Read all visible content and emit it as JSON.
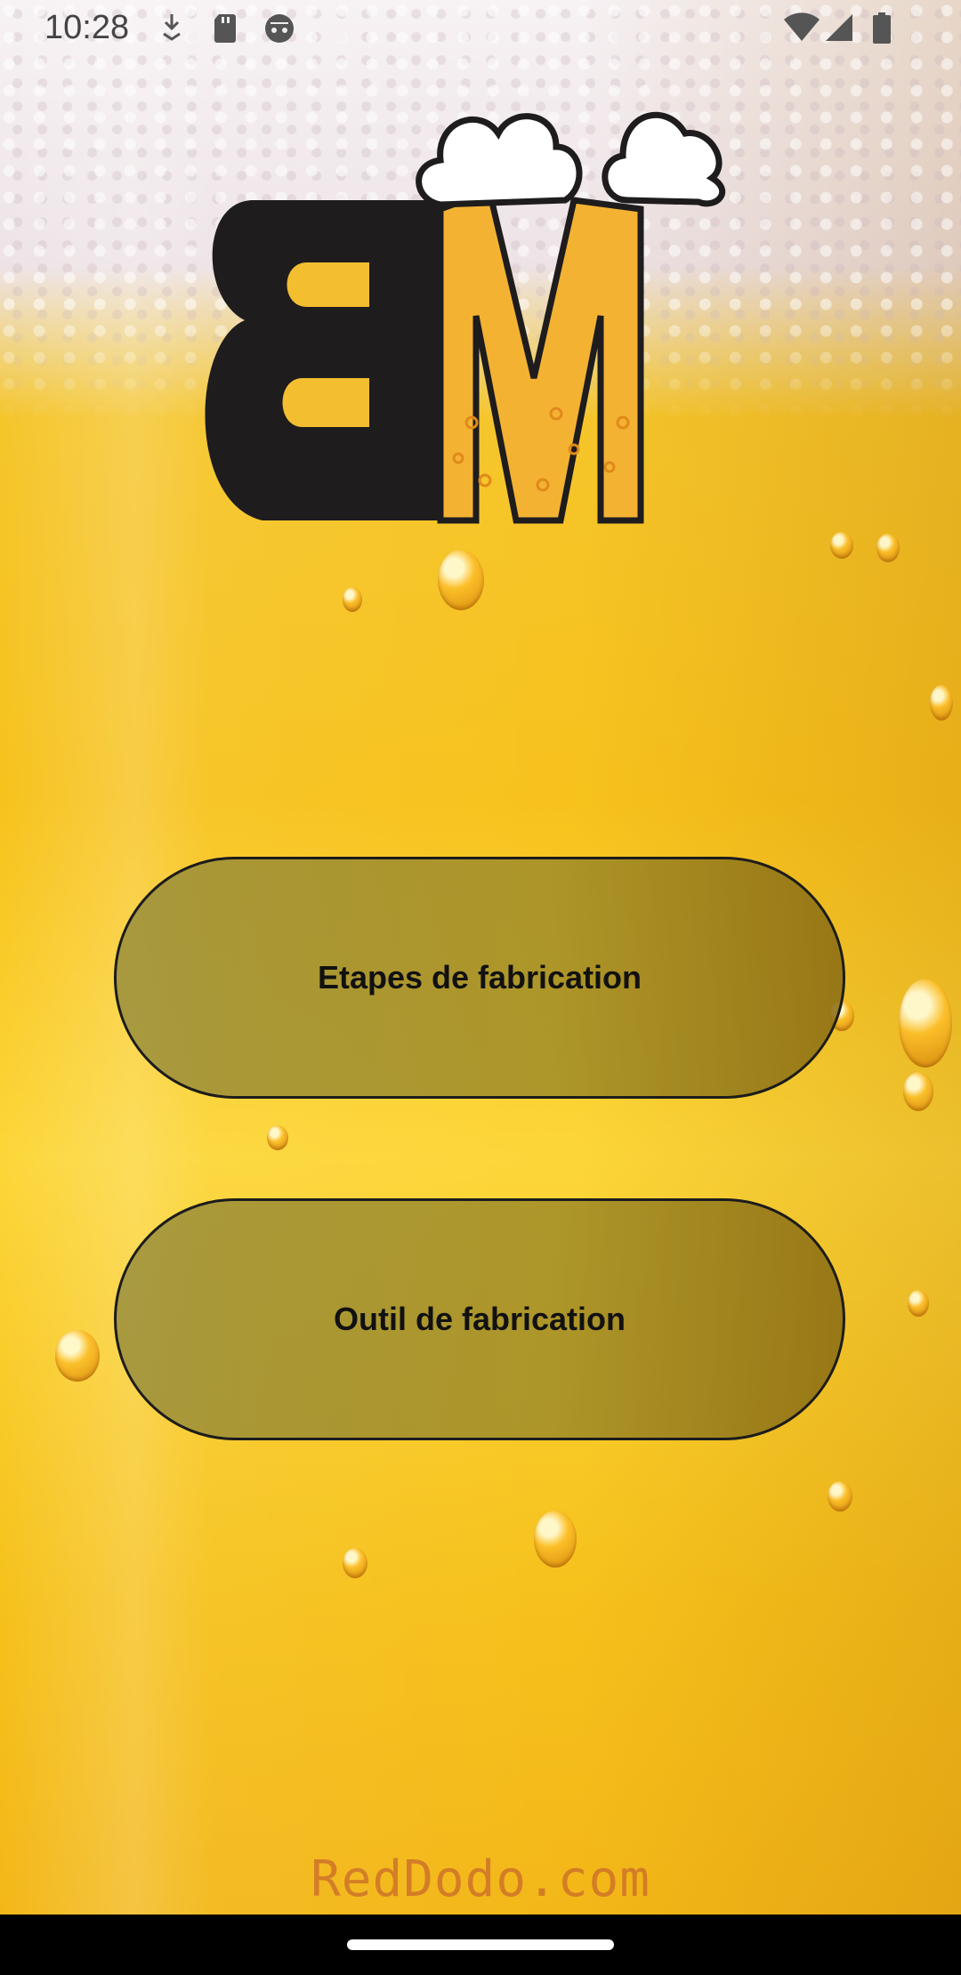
{
  "status_bar": {
    "time": "10:28",
    "icons": [
      "download-icon",
      "sd-card-icon",
      "android-face-icon",
      "wifi-icon",
      "cell-signal-icon",
      "battery-icon"
    ]
  },
  "logo": {
    "text": "BM",
    "colors": {
      "dark": "#1e1c1d",
      "beer": "#f4b233",
      "foam": "#ffffff"
    }
  },
  "buttons": {
    "steps_label": "Etapes de fabrication",
    "tool_label": "Outil de fabrication"
  },
  "watermark": {
    "text": "RedDodo.com"
  },
  "colors": {
    "beer": "#f7c21c",
    "foam": "#ede3e6",
    "button_fill": "#9c8d3c",
    "button_border": "#1c1c1c",
    "nav_bar": "#000000"
  }
}
